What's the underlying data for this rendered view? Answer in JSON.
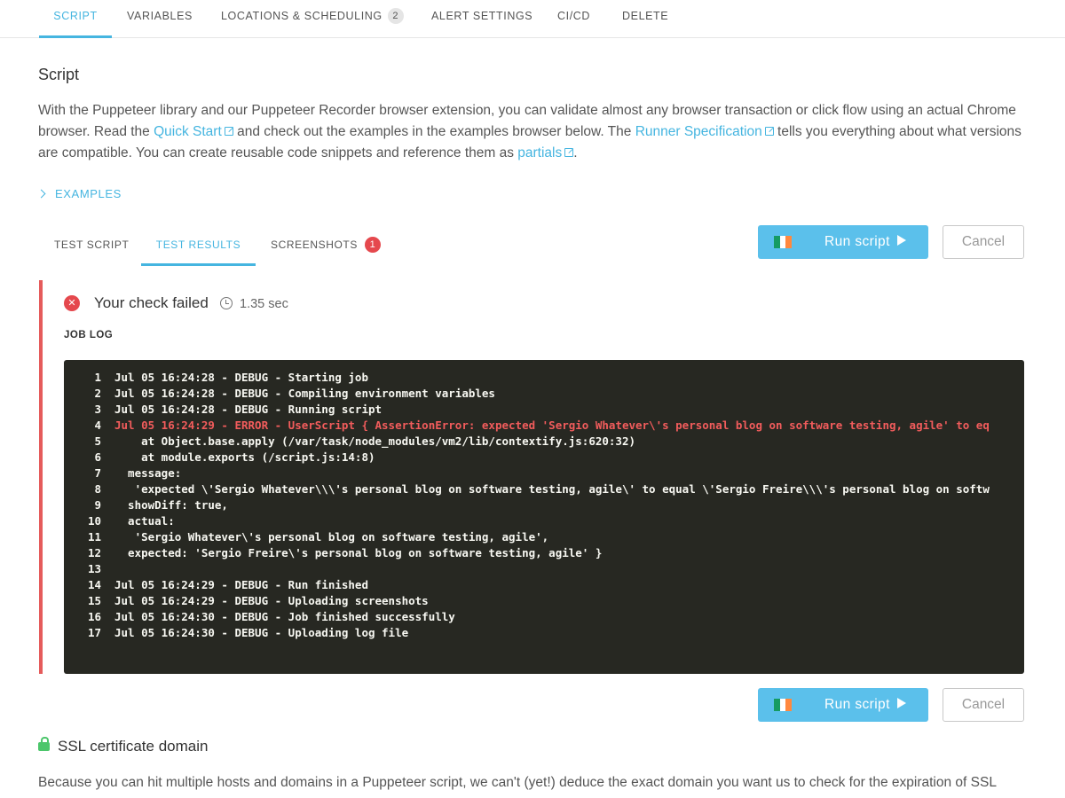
{
  "top_tabs": [
    {
      "label": "SCRIPT"
    },
    {
      "label": "VARIABLES"
    },
    {
      "label": "LOCATIONS & SCHEDULING",
      "badge": "2"
    },
    {
      "label": "ALERT SETTINGS"
    },
    {
      "label": "CI/CD"
    },
    {
      "label": "DELETE"
    }
  ],
  "script": {
    "title": "Script",
    "intro_1": "With the Puppeteer library and our Puppeteer Recorder browser extension, you can validate almost any browser transaction or click flow using an actual Chrome browser. Read the ",
    "link_quick_start": "Quick Start",
    "intro_2": " and check out the examples in the examples browser below. The ",
    "link_runner": "Runner Specification",
    "intro_3": " tells you everything about what versions are compatible. You can create reusable code snippets and reference them as ",
    "link_partials": "partials",
    "intro_4": "."
  },
  "examples_label": "EXAMPLES",
  "sub_tabs": [
    {
      "label": "TEST SCRIPT"
    },
    {
      "label": "TEST RESULTS"
    },
    {
      "label": "SCREENSHOTS",
      "badge": "1"
    }
  ],
  "run_button_label": "Run script",
  "cancel_button_label": "Cancel",
  "result": {
    "status_text": "Your check failed",
    "duration": "1.35 sec",
    "job_log_label": "JOB LOG"
  },
  "job_log": [
    {
      "n": "1",
      "text": "Jul 05 16:24:28 - DEBUG - Starting job"
    },
    {
      "n": "2",
      "text": "Jul 05 16:24:28 - DEBUG - Compiling environment variables"
    },
    {
      "n": "3",
      "text": "Jul 05 16:24:28 - DEBUG - Running script"
    },
    {
      "n": "4",
      "text": "Jul 05 16:24:29 - ERROR - UserScript { AssertionError: expected 'Sergio Whatever\\'s personal blog on software testing, agile' to eq"
    },
    {
      "n": "5",
      "text": "    at Object.base.apply (/var/task/node_modules/vm2/lib/contextify.js:620:32)"
    },
    {
      "n": "6",
      "text": "    at module.exports (/script.js:14:8)"
    },
    {
      "n": "7",
      "text": "  message:"
    },
    {
      "n": "8",
      "text": "   'expected \\'Sergio Whatever\\\\\\'s personal blog on software testing, agile\\' to equal \\'Sergio Freire\\\\\\'s personal blog on softw"
    },
    {
      "n": "9",
      "text": "  showDiff: true,"
    },
    {
      "n": "10",
      "text": "  actual:"
    },
    {
      "n": "11",
      "text": "   'Sergio Whatever\\'s personal blog on software testing, agile',"
    },
    {
      "n": "12",
      "text": "  expected: 'Sergio Freire\\'s personal blog on software testing, agile' }"
    },
    {
      "n": "13",
      "text": ""
    },
    {
      "n": "14",
      "text": "Jul 05 16:24:29 - DEBUG - Run finished"
    },
    {
      "n": "15",
      "text": "Jul 05 16:24:29 - DEBUG - Uploading screenshots"
    },
    {
      "n": "16",
      "text": "Jul 05 16:24:30 - DEBUG - Job finished successfully"
    },
    {
      "n": "17",
      "text": "Jul 05 16:24:30 - DEBUG - Uploading log file"
    }
  ],
  "ssl": {
    "title": "SSL certificate domain",
    "text": "Because you can hit multiple hosts and domains in a Puppeteer script, we can't (yet!) deduce the exact domain you want us to check for the expiration of SSL"
  },
  "colors": {
    "accent": "#45b5e0",
    "run_button": "#5bc0eb",
    "error": "#e5484d",
    "log_bg": "#272822",
    "lock": "#4cc66b"
  },
  "icons": [
    "external-link-icon",
    "chevron-right-icon",
    "flag-ireland-icon",
    "play-icon",
    "failed-x-icon",
    "clock-icon",
    "lock-icon"
  ]
}
